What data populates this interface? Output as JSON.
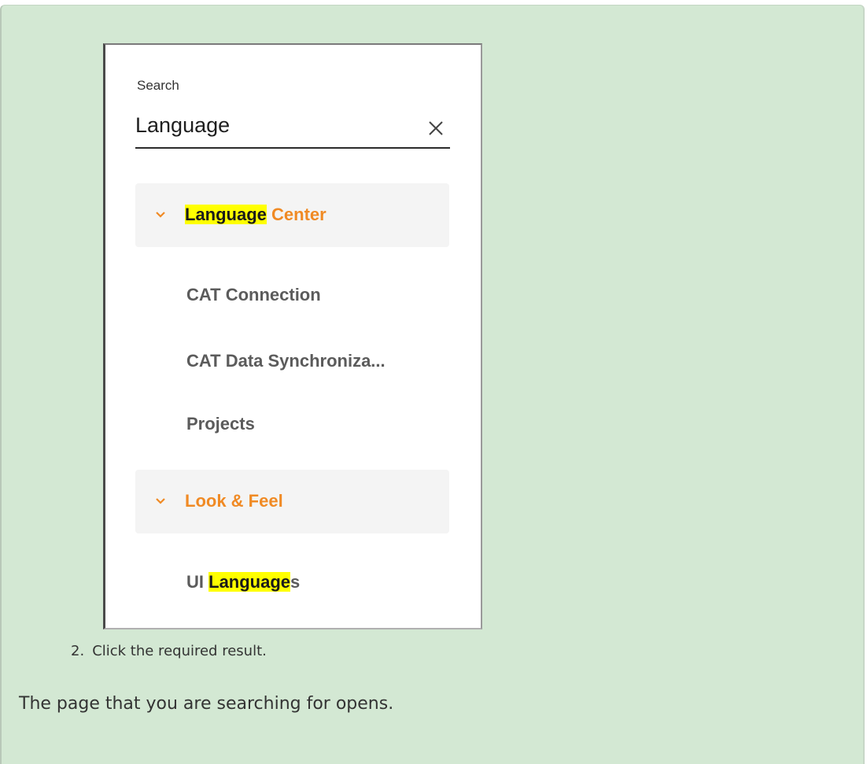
{
  "search": {
    "label": "Search",
    "value": "Language",
    "clear_icon": "close-icon"
  },
  "groups": [
    {
      "highlight": "Language",
      "rest": " Center",
      "expanded": true,
      "items": [
        "CAT Connection",
        "CAT Data Synchroniza...",
        "Projects"
      ]
    },
    {
      "title": "Look & Feel",
      "expanded": true,
      "items": [
        {
          "prefix": "UI ",
          "highlight": "Language",
          "suffix": "s"
        }
      ]
    }
  ],
  "colors": {
    "accent": "#f08a24",
    "highlight": "#ffff00",
    "item_text": "#5b5b5b",
    "panel_bg": "#d3e8d3"
  },
  "instructions": {
    "step_number": "2.",
    "step_text": "Click the required result.",
    "result_text": "The page that you are searching for opens."
  }
}
